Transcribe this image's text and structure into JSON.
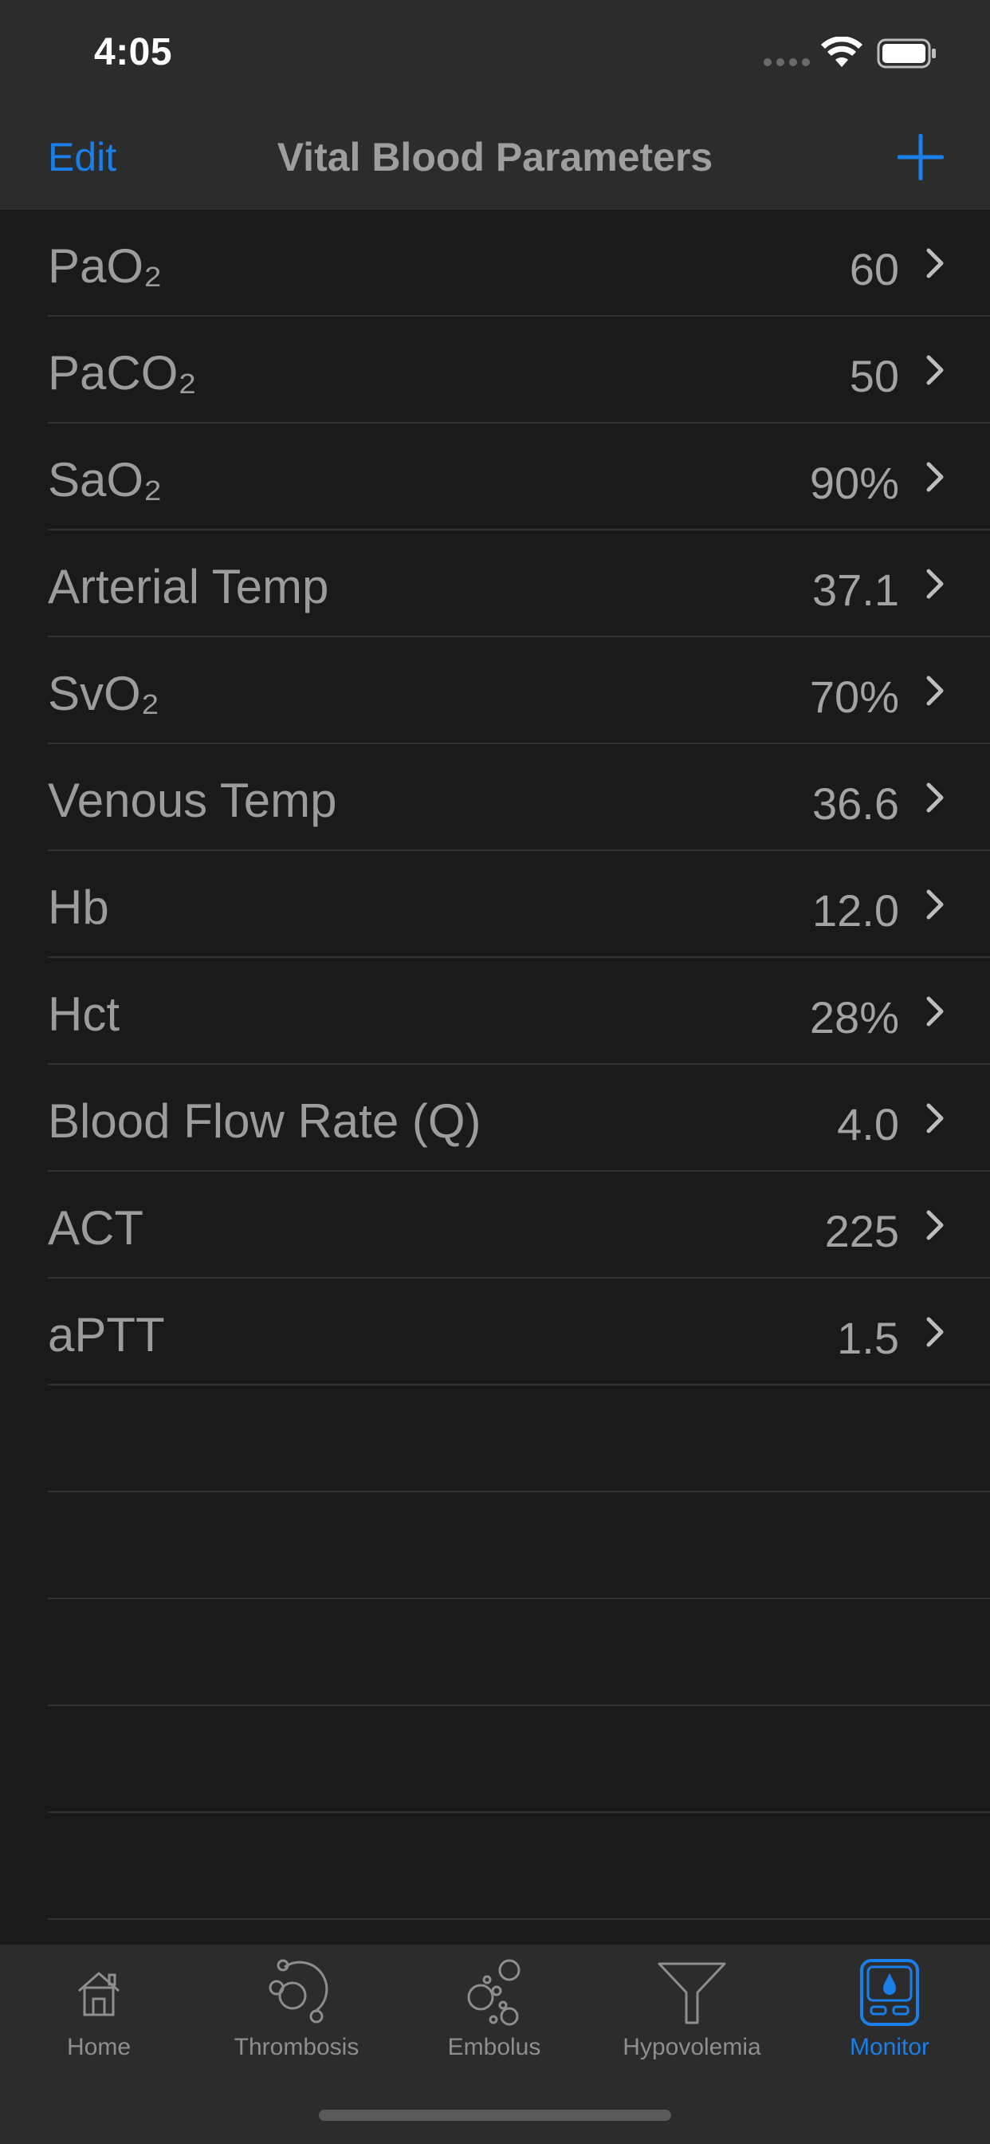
{
  "status_bar": {
    "time": "4:05"
  },
  "nav": {
    "edit_label": "Edit",
    "title": "Vital Blood Parameters",
    "add_icon": "plus-icon"
  },
  "colors": {
    "accent": "#1a7fe8",
    "background": "#1a1a1a",
    "bar_background": "#2c2c2c"
  },
  "parameters": [
    {
      "label": "PaO₂",
      "value": "60"
    },
    {
      "label": "PaCO₂",
      "value": "50"
    },
    {
      "label": "SaO₂",
      "value": "90%"
    },
    {
      "label": "Arterial Temp",
      "value": "37.1"
    },
    {
      "label": "SvO₂",
      "value": "70%"
    },
    {
      "label": "Venous Temp",
      "value": "36.6"
    },
    {
      "label": "Hb",
      "value": "12.0"
    },
    {
      "label": "Hct",
      "value": "28%"
    },
    {
      "label": "Blood Flow Rate (Q)",
      "value": "4.0"
    },
    {
      "label": "ACT",
      "value": "225"
    },
    {
      "label": "aPTT",
      "value": "1.5"
    }
  ],
  "tabs": [
    {
      "label": "Home",
      "icon": "house-icon",
      "active": false
    },
    {
      "label": "Thrombosis",
      "icon": "thrombosis-icon",
      "active": false
    },
    {
      "label": "Embolus",
      "icon": "bubbles-icon",
      "active": false
    },
    {
      "label": "Hypovolemia",
      "icon": "funnel-icon",
      "active": false
    },
    {
      "label": "Monitor",
      "icon": "monitor-device-icon",
      "active": true
    }
  ]
}
